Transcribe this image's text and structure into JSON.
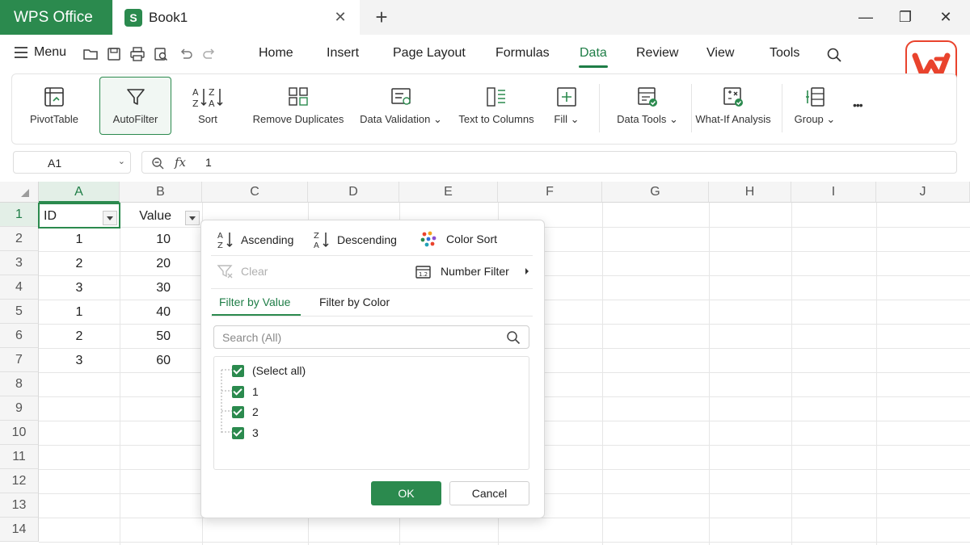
{
  "titlebar": {
    "app_name": "WPS Office",
    "doc_name": "Book1",
    "doc_icon_letter": "S",
    "close_glyph": "✕",
    "new_tab_glyph": "+",
    "minimize_glyph": "—",
    "maximize_glyph": "❐",
    "window_close_glyph": "✕"
  },
  "menubar": {
    "menu_label": "Menu",
    "tabs": [
      "Home",
      "Insert",
      "Page Layout",
      "Formulas",
      "Data",
      "Review",
      "View",
      "Tools"
    ],
    "active_tab": "Data"
  },
  "ribbon": {
    "items": [
      {
        "label": "PivotTable",
        "icon": "pivottable-icon"
      },
      {
        "label": "AutoFilter",
        "icon": "autofilter-icon"
      },
      {
        "label": "Sort",
        "icon": "sort-icon"
      },
      {
        "label": "Remove Duplicates",
        "icon": "remove-duplicates-icon"
      },
      {
        "label": "Data Validation",
        "icon": "data-validation-icon"
      },
      {
        "label": "Text to Columns",
        "icon": "text-to-columns-icon"
      },
      {
        "label": "Fill",
        "icon": "fill-icon"
      },
      {
        "label": "Data Tools",
        "icon": "data-tools-icon"
      },
      {
        "label": "What-If Analysis",
        "icon": "what-if-icon"
      },
      {
        "label": "Group",
        "icon": "group-icon"
      }
    ],
    "more_glyph": "•••",
    "dropdown_glyph": "⌄"
  },
  "formula_bar": {
    "name_box": "A1",
    "fx": "fx",
    "value": "1"
  },
  "sheet": {
    "columns": [
      "A",
      "B",
      "C",
      "D",
      "E",
      "F",
      "G",
      "H",
      "I",
      "J"
    ],
    "rows": [
      "1",
      "2",
      "3",
      "4",
      "5",
      "6",
      "7",
      "8",
      "9",
      "10",
      "11",
      "12",
      "13",
      "14"
    ],
    "header_row": [
      "ID",
      "Value"
    ],
    "data": [
      [
        "1",
        "10"
      ],
      [
        "2",
        "20"
      ],
      [
        "3",
        "30"
      ],
      [
        "1",
        "40"
      ],
      [
        "2",
        "50"
      ],
      [
        "3",
        "60"
      ]
    ]
  },
  "filter_dropdown": {
    "ascending": "Ascending",
    "descending": "Descending",
    "color_sort": "Color Sort",
    "clear": "Clear",
    "number_filter": "Number Filter",
    "tabs": [
      "Filter by Value",
      "Filter by Color"
    ],
    "active_tab": "Filter by Value",
    "search_placeholder": "Search (All)",
    "items": [
      {
        "label": "(Select all)",
        "checked": true
      },
      {
        "label": "1",
        "checked": true
      },
      {
        "label": "2",
        "checked": true
      },
      {
        "label": "3",
        "checked": true
      }
    ],
    "ok": "OK",
    "cancel": "Cancel"
  },
  "colors": {
    "accent": "#2b8a4e",
    "wps_red": "#e9432d"
  }
}
